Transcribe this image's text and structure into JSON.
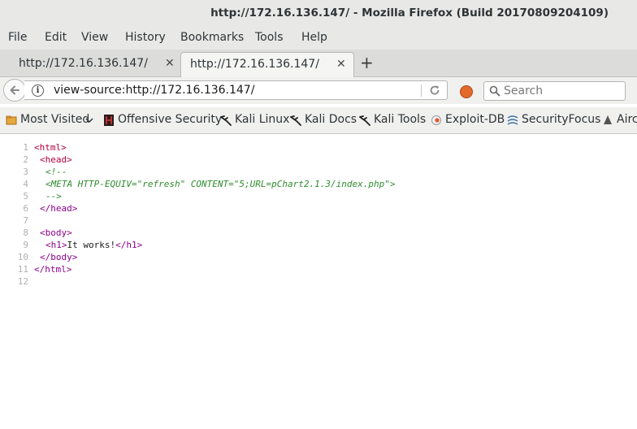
{
  "window": {
    "title": "http://172.16.136.147/ - Mozilla Firefox (Build 20170809204109)"
  },
  "menu": [
    "File",
    "Edit",
    "View",
    "History",
    "Bookmarks",
    "Tools",
    "Help"
  ],
  "tabs": [
    {
      "label": "http://172.16.136.147/",
      "active": false
    },
    {
      "label": "http://172.16.136.147/",
      "active": true
    }
  ],
  "nav": {
    "url": "view-source:http://172.16.136.147/",
    "search_placeholder": "Search"
  },
  "bookmarks": [
    {
      "label": "Most Visited",
      "icon": "folder-icon"
    },
    {
      "label": "Offensive Security",
      "icon": "offsec-icon"
    },
    {
      "label": "Kali Linux",
      "icon": "kali-dragon-icon"
    },
    {
      "label": "Kali Docs",
      "icon": "kali-dragon-icon"
    },
    {
      "label": "Kali Tools",
      "icon": "kali-dragon-icon"
    },
    {
      "label": "Exploit-DB",
      "icon": "exploitdb-icon"
    },
    {
      "label": "SecurityFocus",
      "icon": "securityfocus-icon"
    },
    {
      "label": "Airc",
      "icon": "aircrack-icon"
    }
  ],
  "source_lines": [
    {
      "n": "1",
      "text": "<html>"
    },
    {
      "n": "2",
      "text": "<head>"
    },
    {
      "n": "3",
      "text": "<!--"
    },
    {
      "n": "4",
      "text": "<META HTTP-EQUIV=\"refresh\" CONTENT=\"5;URL=pChart2.1.3/index.php\">"
    },
    {
      "n": "5",
      "text": "-->"
    },
    {
      "n": "6",
      "text": "</head>"
    },
    {
      "n": "7",
      "text": ""
    },
    {
      "n": "8",
      "text": "<body>"
    },
    {
      "n": "9",
      "open": "<h1>",
      "inner": "It works!",
      "close": "</h1>"
    },
    {
      "n": "10",
      "text": "</body>"
    },
    {
      "n": "11",
      "text": "</html>"
    },
    {
      "n": "12",
      "text": ""
    }
  ]
}
